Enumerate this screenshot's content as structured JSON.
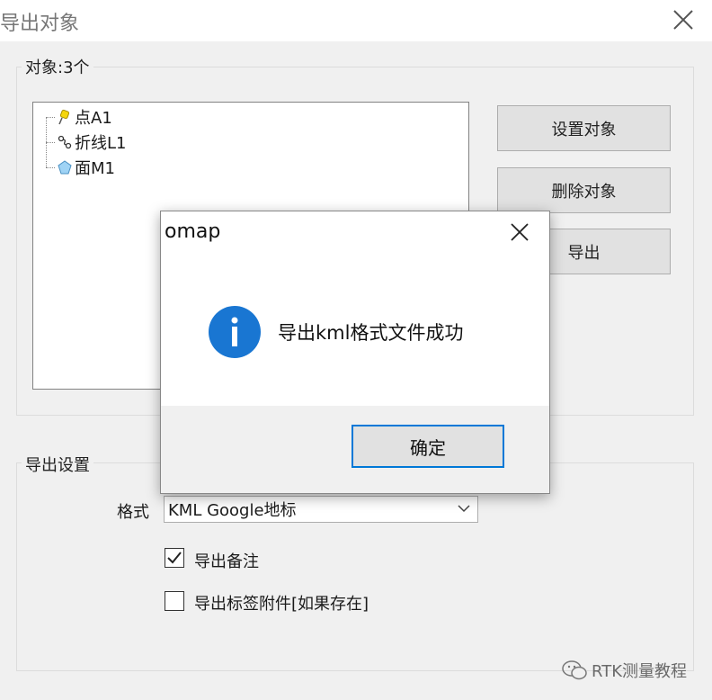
{
  "window": {
    "title": "导出对象"
  },
  "objects_group": {
    "label": "对象:3个",
    "items": [
      {
        "label": "点A1",
        "icon": "pushpin-icon"
      },
      {
        "label": "折线L1",
        "icon": "polyline-icon"
      },
      {
        "label": "面M1",
        "icon": "polygon-icon"
      }
    ],
    "buttons": {
      "set": "设置对象",
      "delete": "删除对象",
      "export": "导出"
    }
  },
  "export_settings": {
    "label": "导出设置",
    "format_label": "格式",
    "format_value": "KML Google地标",
    "export_notes": {
      "label": "导出备注",
      "checked": true
    },
    "export_attachments": {
      "label": "导出标签附件[如果存在]",
      "checked": false
    }
  },
  "dialog": {
    "title": "omap",
    "message": "导出kml格式文件成功",
    "ok_label": "确定",
    "icon": "info-icon",
    "icon_color": "#1976d2"
  },
  "watermark": {
    "text": "RTK测量教程"
  }
}
